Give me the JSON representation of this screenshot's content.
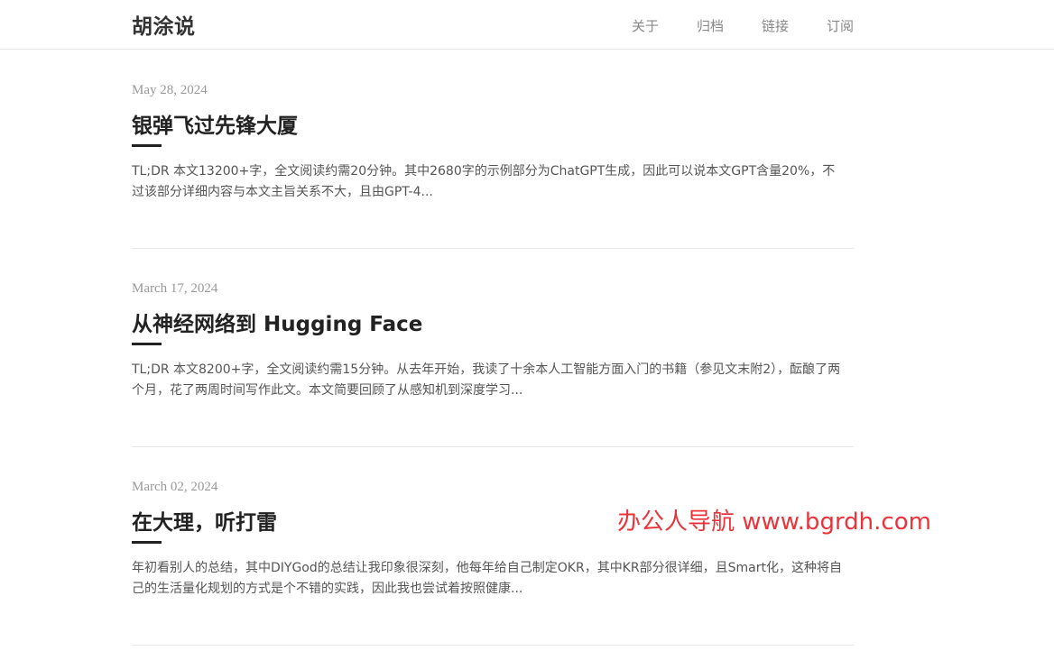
{
  "header": {
    "site_title": "胡涂说",
    "nav": [
      "关于",
      "归档",
      "链接",
      "订阅"
    ]
  },
  "posts": [
    {
      "date": "May 28, 2024",
      "title": "银弹飞过先锋大厦",
      "excerpt": "TL;DR 本文13200+字，全文阅读约需20分钟。其中2680字的示例部分为ChatGPT生成，因此可以说本文GPT含量20%，不过该部分详细内容与本文主旨关系不大，且由GPT-4..."
    },
    {
      "date": "March 17, 2024",
      "title": "从神经网络到 Hugging Face",
      "excerpt": "TL;DR 本文8200+字，全文阅读约需15分钟。从去年开始，我读了十余本人工智能方面入门的书籍（参见文末附2），酝酿了两个月，花了两周时间写作此文。本文简要回顾了从感知机到深度学习..."
    },
    {
      "date": "March 02, 2024",
      "title": "在大理，听打雷",
      "excerpt": "年初看别人的总结，其中DIYGod的总结让我印象很深刻，他每年给自己制定OKR，其中KR部分很详细，且Smart化，这种将自己的生活量化规划的方式是个不错的实践，因此我也尝试着按照健康..."
    }
  ],
  "watermark": "办公人导航  www.bgrdh.com",
  "colors": {
    "watermark": "#e8343a",
    "title": "#222222",
    "date": "#999999",
    "nav": "#888888"
  }
}
